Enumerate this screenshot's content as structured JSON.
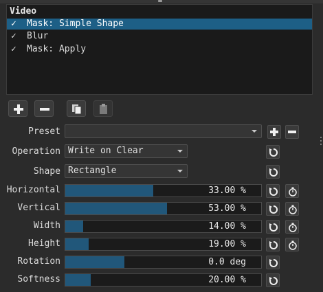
{
  "filters": {
    "header": "Video",
    "items": [
      {
        "label": "Mask: Simple Shape",
        "check": "✓",
        "selected": true
      },
      {
        "label": "Blur",
        "check": "✓",
        "selected": false
      },
      {
        "label": "Mask: Apply",
        "check": "✓",
        "selected": false
      }
    ]
  },
  "toolbar": {
    "buttons": [
      "add-icon",
      "remove-icon",
      "copy-icon",
      "paste-icon"
    ]
  },
  "preset": {
    "label": "Preset",
    "value": ""
  },
  "operation": {
    "label": "Operation",
    "value": "Write on Clear"
  },
  "shape": {
    "label": "Shape",
    "value": "Rectangle"
  },
  "params": [
    {
      "label": "Horizontal",
      "value": "33.00 %",
      "level": 0.45,
      "keyframe": true
    },
    {
      "label": "Vertical",
      "value": "53.00 %",
      "level": 0.52,
      "keyframe": true
    },
    {
      "label": "Width",
      "value": "14.00 %",
      "level": 0.09,
      "keyframe": true
    },
    {
      "label": "Height",
      "value": "19.00 %",
      "level": 0.12,
      "keyframe": true
    },
    {
      "label": "Rotation",
      "value": "0.0 deg",
      "level": 0.3,
      "keyframe": false
    },
    {
      "label": "Softness",
      "value": "20.00 %",
      "level": 0.13,
      "keyframe": false
    }
  ],
  "colors": {
    "accent": "#1d5f86",
    "slider_fill": "#21577a",
    "background": "#2b2b2b"
  }
}
